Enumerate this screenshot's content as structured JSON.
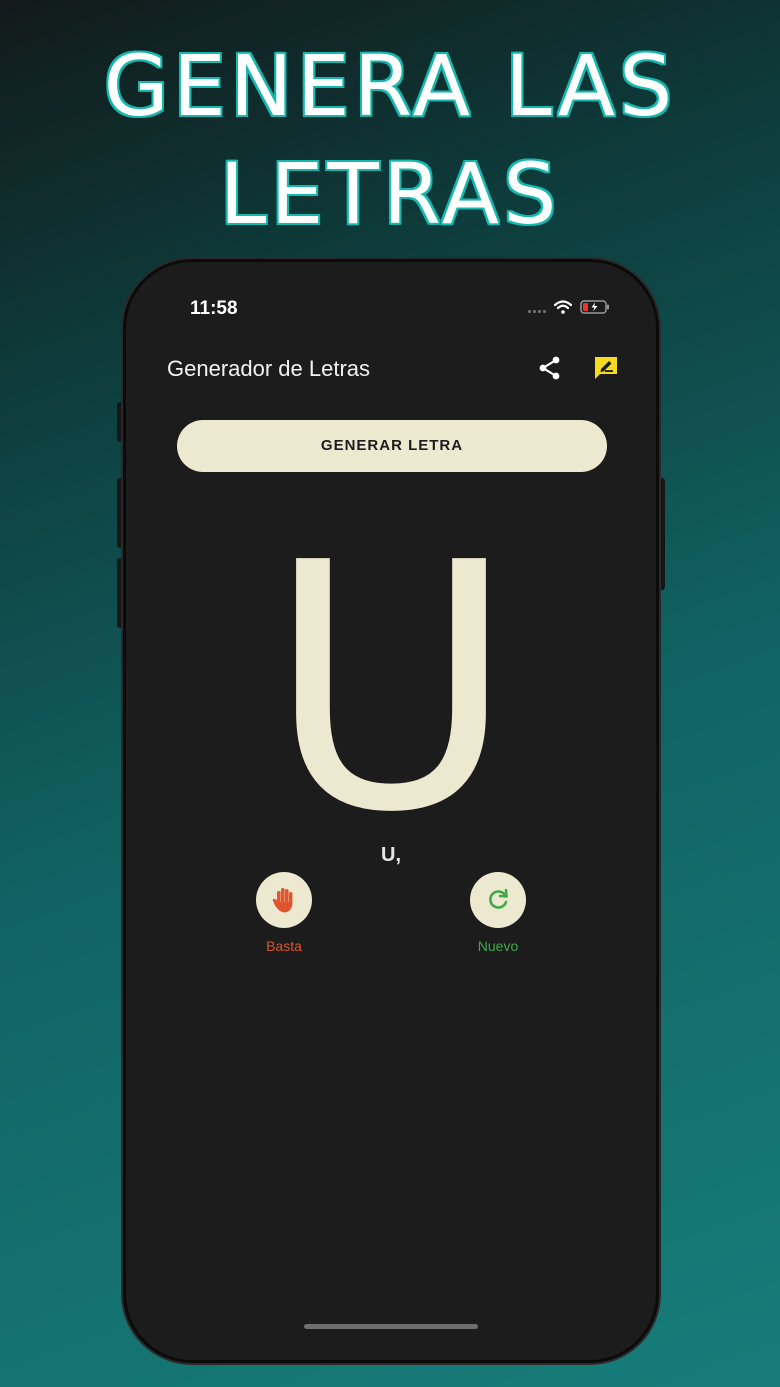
{
  "promo": {
    "headline_line1": "GENERA LAS",
    "headline_line2": "LETRAS"
  },
  "status_bar": {
    "time": "11:58",
    "icons": [
      "cellular-dots-icon",
      "wifi-icon",
      "battery-low-charging-icon"
    ]
  },
  "app_bar": {
    "title": "Generador de Letras",
    "actions": [
      "share-icon",
      "feedback-note-icon"
    ]
  },
  "main": {
    "generate_button_label": "GENERAR LETRA",
    "current_letter": "U",
    "history": "U,"
  },
  "actions": {
    "stop": {
      "label": "Basta",
      "icon": "hand-stop-icon",
      "color": "#e05530"
    },
    "new": {
      "label": "Nuevo",
      "icon": "refresh-icon",
      "color": "#3faa4a"
    }
  },
  "colors": {
    "accent_cream": "#ede8d0",
    "feedback_icon": "#f5dc22",
    "screen_bg": "#1c1c1c"
  }
}
